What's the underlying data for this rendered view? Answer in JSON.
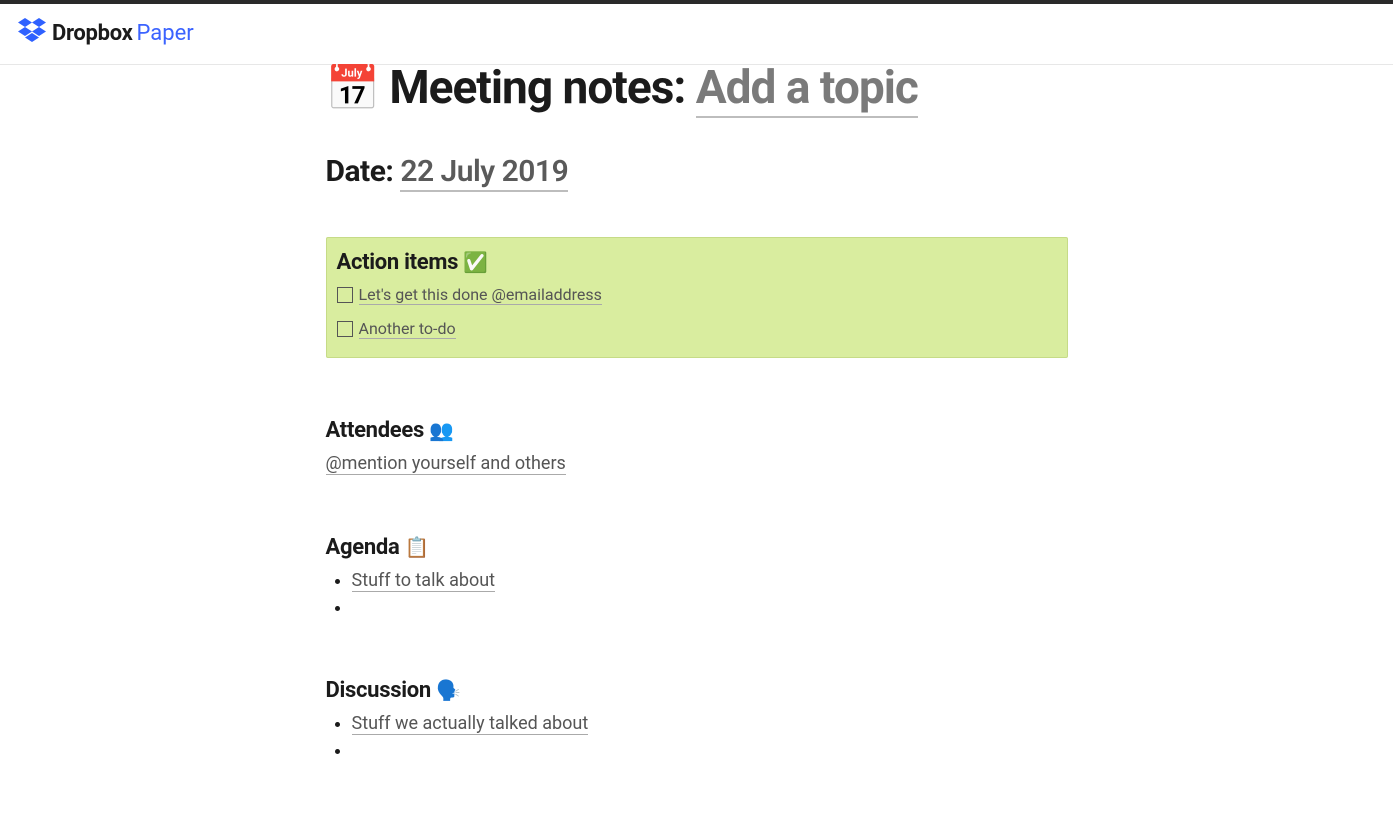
{
  "brand": {
    "name": "Dropbox",
    "product": "Paper"
  },
  "title": {
    "prefix": "Meeting notes: ",
    "placeholder": "Add a topic",
    "emoji": "📅"
  },
  "date": {
    "label": "Date: ",
    "value": "22 July 2019"
  },
  "actionItems": {
    "heading": "Action items",
    "emoji": "✅",
    "items": [
      {
        "text": "Let's get this done @emailaddress",
        "checked": false
      },
      {
        "text": "Another to-do",
        "checked": false
      }
    ]
  },
  "attendees": {
    "heading": "Attendees",
    "emoji": "👥",
    "placeholder": "@mention yourself and others"
  },
  "agenda": {
    "heading": "Agenda",
    "emoji": "📋",
    "items": [
      "Stuff to talk about"
    ]
  },
  "discussion": {
    "heading": "Discussion",
    "emoji": "🗣️",
    "items": [
      "Stuff we actually talked about"
    ]
  }
}
